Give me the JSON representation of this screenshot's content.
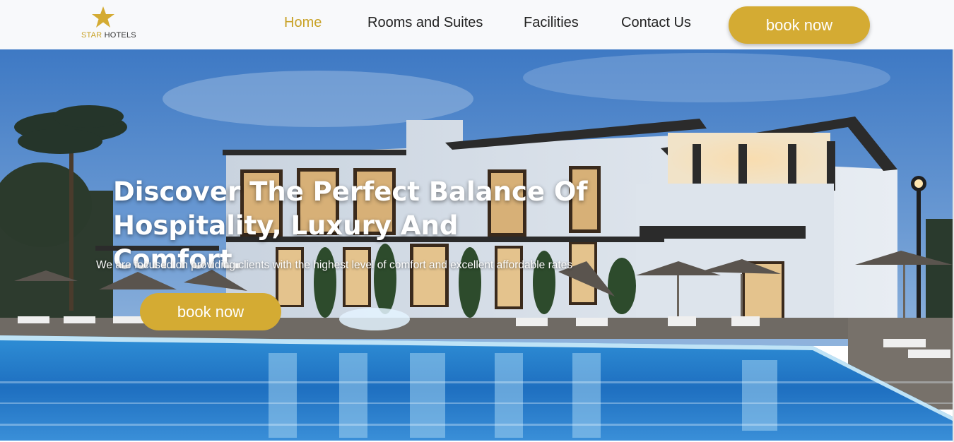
{
  "brand": {
    "name_part1": "STAR",
    "name_part2": " HOTELS",
    "icon": "star-icon",
    "accent": "#d4ab33"
  },
  "nav": {
    "links": [
      {
        "label": "Home",
        "active": true
      },
      {
        "label": "Rooms and Suites",
        "active": false
      },
      {
        "label": "Facilities",
        "active": false
      },
      {
        "label": "Contact Us",
        "active": false
      }
    ],
    "cta": "book now"
  },
  "hero": {
    "title_line1": "Discover The Perfect Balance Of",
    "title_line2": "Hospitality, Luxury And Comfort.",
    "subtitle": "We are focused on providing clients with the highest level of comfort and excellent affordable rates",
    "cta": "book now",
    "image": "hotel-pool-night-photo"
  }
}
